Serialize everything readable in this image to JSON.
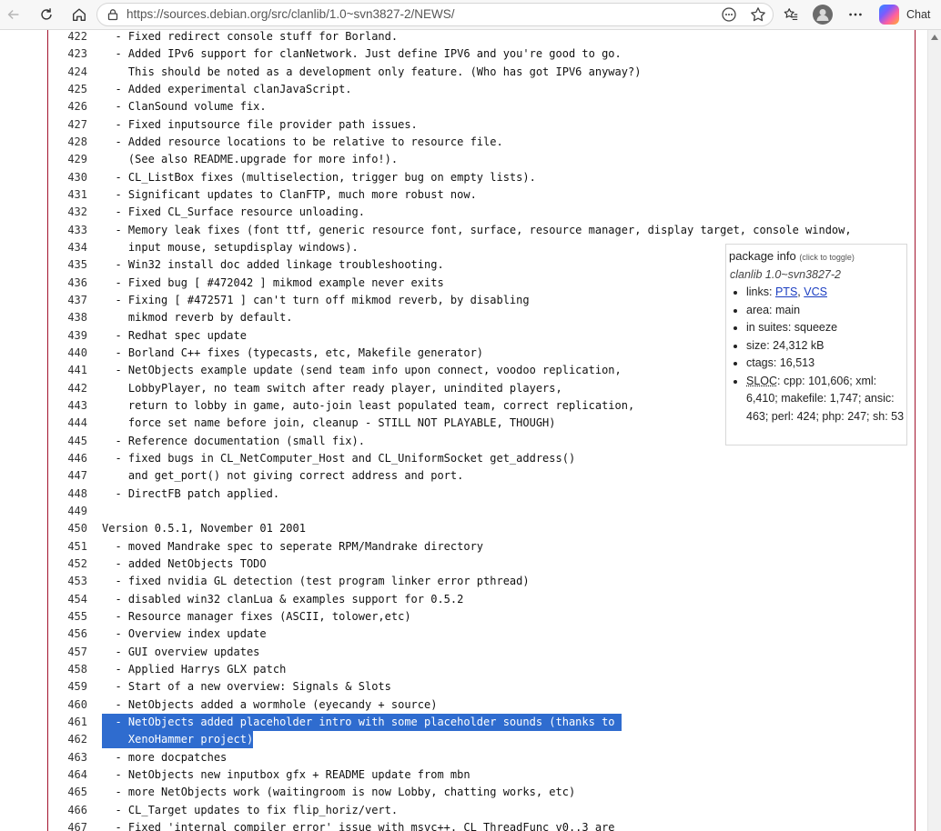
{
  "browser": {
    "url": "https://sources.debian.org/src/clanlib/1.0~svn3827-2/NEWS/",
    "chat_label": "Chat"
  },
  "lines": [
    {
      "n": "422",
      "t": "  - Fixed redirect console stuff for Borland."
    },
    {
      "n": "423",
      "t": "  - Added IPv6 support for clanNetwork. Just define IPV6 and you're good to go."
    },
    {
      "n": "424",
      "t": "    This should be noted as a development only feature. (Who has got IPV6 anyway?)"
    },
    {
      "n": "425",
      "t": "  - Added experimental clanJavaScript."
    },
    {
      "n": "426",
      "t": "  - ClanSound volume fix."
    },
    {
      "n": "427",
      "t": "  - Fixed inputsource file provider path issues."
    },
    {
      "n": "428",
      "t": "  - Added resource locations to be relative to resource file."
    },
    {
      "n": "429",
      "t": "    (See also README.upgrade for more info!)."
    },
    {
      "n": "430",
      "t": "  - CL_ListBox fixes (multiselection, trigger bug on empty lists)."
    },
    {
      "n": "431",
      "t": "  - Significant updates to ClanFTP, much more robust now."
    },
    {
      "n": "432",
      "t": "  - Fixed CL_Surface resource unloading."
    },
    {
      "n": "433",
      "t": "  - Memory leak fixes (font ttf, generic resource font, surface, resource manager, display target, console window,"
    },
    {
      "n": "434",
      "t": "    input mouse, setupdisplay windows)."
    },
    {
      "n": "435",
      "t": "  - Win32 install doc added linkage troubleshooting."
    },
    {
      "n": "436",
      "t": "  - Fixed bug [ #472042 ] mikmod example never exits"
    },
    {
      "n": "437",
      "t": "  - Fixing [ #472571 ] can't turn off mikmod reverb, by disabling"
    },
    {
      "n": "438",
      "t": "    mikmod reverb by default."
    },
    {
      "n": "439",
      "t": "  - Redhat spec update"
    },
    {
      "n": "440",
      "t": "  - Borland C++ fixes (typecasts, etc, Makefile generator)"
    },
    {
      "n": "441",
      "t": "  - NetObjects example update (send team info upon connect, voodoo replication,"
    },
    {
      "n": "442",
      "t": "    LobbyPlayer, no team switch after ready player, unindited players,"
    },
    {
      "n": "443",
      "t": "    return to lobby in game, auto-join least populated team, correct replication,"
    },
    {
      "n": "444",
      "t": "    force set name before join, cleanup - STILL NOT PLAYABLE, THOUGH)"
    },
    {
      "n": "445",
      "t": "  - Reference documentation (small fix)."
    },
    {
      "n": "446",
      "t": "  - fixed bugs in CL_NetComputer_Host and CL_UniformSocket get_address()"
    },
    {
      "n": "447",
      "t": "    and get_port() not giving correct address and port."
    },
    {
      "n": "448",
      "t": "  - DirectFB patch applied."
    },
    {
      "n": "449",
      "t": ""
    },
    {
      "n": "450",
      "t": "Version 0.5.1, November 01 2001"
    },
    {
      "n": "451",
      "t": "  - moved Mandrake spec to seperate RPM/Mandrake directory"
    },
    {
      "n": "452",
      "t": "  - added NetObjects TODO"
    },
    {
      "n": "453",
      "t": "  - fixed nvidia GL detection (test program linker error pthread)"
    },
    {
      "n": "454",
      "t": "  - disabled win32 clanLua & examples support for 0.5.2"
    },
    {
      "n": "455",
      "t": "  - Resource manager fixes (ASCII, tolower,etc)"
    },
    {
      "n": "456",
      "t": "  - Overview index update"
    },
    {
      "n": "457",
      "t": "  - GUI overview updates"
    },
    {
      "n": "458",
      "t": "  - Applied Harrys GLX patch"
    },
    {
      "n": "459",
      "t": "  - Start of a new overview: Signals & Slots"
    },
    {
      "n": "460",
      "t": "  - NetObjects added a wormhole (eyecandy + source)"
    },
    {
      "n": "461",
      "t": "  - NetObjects added placeholder intro with some placeholder sounds (thanks to ",
      "hl": true
    },
    {
      "n": "462",
      "t": "    XenoHammer project)",
      "hl": true
    },
    {
      "n": "463",
      "t": "  - more docpatches"
    },
    {
      "n": "464",
      "t": "  - NetObjects new inputbox gfx + README update from mbn"
    },
    {
      "n": "465",
      "t": "  - more NetObjects work (waitingroom is now Lobby, chatting works, etc)"
    },
    {
      "n": "466",
      "t": "  - CL_Target updates to fix flip_horiz/vert."
    },
    {
      "n": "467",
      "t": "  - Fixed 'internal compiler error' issue with msvc++. CL_ThreadFunc_v0..3 are"
    }
  ],
  "package_info": {
    "title": "package info",
    "toggle_hint": "(click to toggle)",
    "version": "clanlib 1.0~svn3827-2",
    "links_label": "links:",
    "link_pts": "PTS",
    "link_sep": ",",
    "link_vcs": "VCS",
    "area": "area: main",
    "suites": "in suites: squeeze",
    "size": "size: 24,312 kB",
    "ctags": "ctags: 16,513",
    "sloc_label": "SLOC",
    "sloc_value": ": cpp: 101,606; xml: 6,410; makefile: 1,747; ansic: 463; perl: 424; php: 247; sh: 53"
  }
}
